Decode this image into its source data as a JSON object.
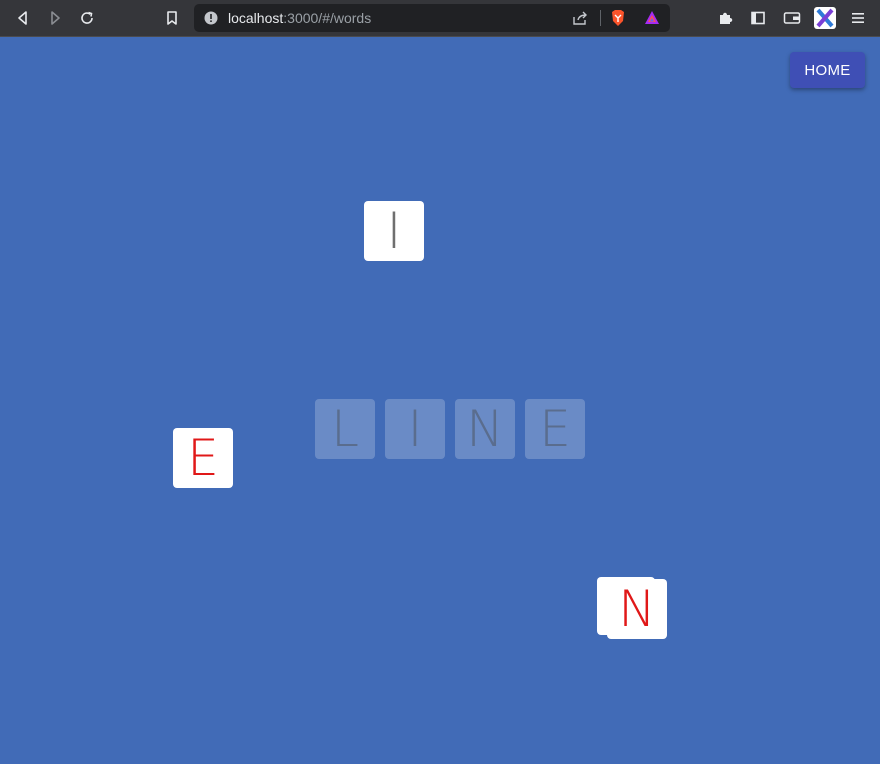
{
  "browser": {
    "url_host": "localhost",
    "url_path": ":3000/#/words"
  },
  "page": {
    "home_label": "HOME",
    "target_word": [
      "L",
      "I",
      "N",
      "E"
    ],
    "tiles": [
      "I",
      "E",
      "N"
    ]
  },
  "colors": {
    "background": "#416bb7",
    "home_button": "#3f4fb5",
    "tile_letter_red": "#e01818",
    "tile_letter_grey": "#6f6f6f"
  }
}
